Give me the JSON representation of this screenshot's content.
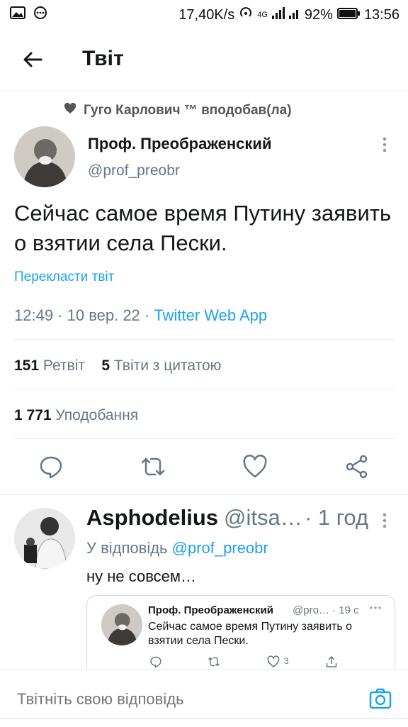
{
  "status": {
    "speed": "17,40K/s",
    "network": "4G",
    "battery": "92%",
    "time": "13:56"
  },
  "header": {
    "title": "Твіт"
  },
  "tweet": {
    "liked_by": "Гуго Карлович ™ вподобав(ла)",
    "author_name": "Проф. Преображенский",
    "author_handle": "@prof_preobr",
    "text": "Сейчас самое время Путину заявить о взятии села Пески.",
    "translate": "Перекласти твіт",
    "time": "12:49 · 10 вер. 22 · ",
    "source": "Twitter Web App",
    "retweets_count": "151",
    "retweets_label": "Ретвіт",
    "quotes_count": "5",
    "quotes_label": "Твіти з цитатою",
    "likes_count": "1 771",
    "likes_label": "Уподобання"
  },
  "reply": {
    "name": "Asphodelius",
    "handle": "@itsa…",
    "time": "· 1 год",
    "replying_to_label": "У відповідь",
    "replying_to_handle": "@prof_preobr",
    "text": "ну не совсем…",
    "quote": {
      "name": "Проф. Преображенский",
      "handle": "@pro… · 19 с",
      "text": "Сейчас самое время Путину заявить о взятии села Пески.",
      "likes": "3"
    }
  },
  "compose": {
    "placeholder": "Твітніть свою відповідь"
  },
  "colors": {
    "accent": "#1da1f2",
    "muted": "#657786",
    "text": "#14171a"
  }
}
